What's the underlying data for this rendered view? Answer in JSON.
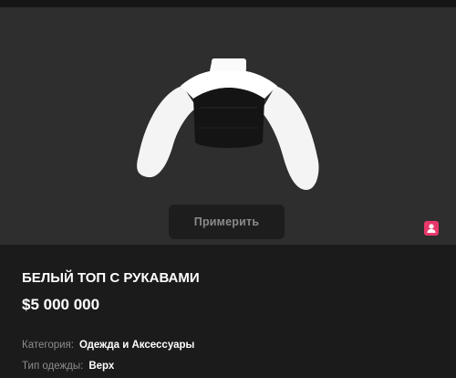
{
  "product": {
    "title": "БЕЛЫЙ ТОП С РУКАВАМИ",
    "price": "$5 000 000",
    "try_on_label": "Примерить"
  },
  "details": [
    {
      "label": "Категория:",
      "value": "Одежда и Аксессуары"
    },
    {
      "label": "Тип одежды:",
      "value": "Верх"
    }
  ],
  "icons": {
    "badge": "user-icon"
  },
  "colors": {
    "preview_bg": "#2e2e2e",
    "page_bg": "#1b1b1b",
    "badge": "#e8386a",
    "muted_text": "#8d8d8d"
  }
}
